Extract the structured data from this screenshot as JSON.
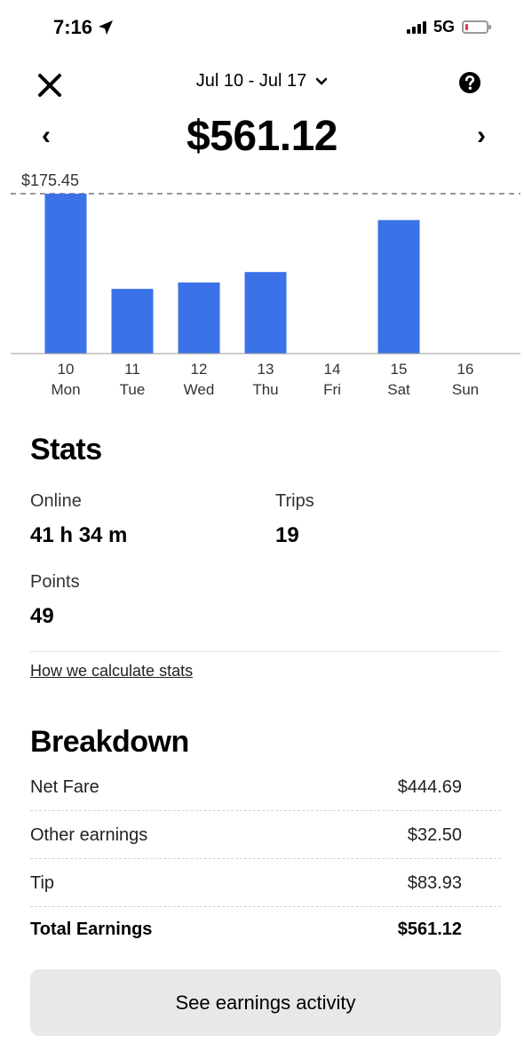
{
  "status_bar": {
    "time": "7:16",
    "network": "5G"
  },
  "header": {
    "date_range": "Jul 10 - Jul 17",
    "total": "$561.12"
  },
  "chart_data": {
    "type": "bar",
    "categories": [
      "10 Mon",
      "11 Tue",
      "12 Wed",
      "13 Thu",
      "14 Fri",
      "15 Sat",
      "16 Sun"
    ],
    "day_numbers": [
      "10",
      "11",
      "12",
      "13",
      "14",
      "15",
      "16"
    ],
    "day_names": [
      "Mon",
      "Tue",
      "Wed",
      "Thu",
      "Fri",
      "Sat",
      "Sun"
    ],
    "values": [
      175.45,
      71,
      78,
      89.5,
      0,
      146.5,
      0
    ],
    "max_label": "$175.45",
    "ylim": [
      0,
      175.45
    ],
    "bar_color": "#3b72e8"
  },
  "stats": {
    "title": "Stats",
    "online_label": "Online",
    "online_value": "41 h 34 m",
    "trips_label": "Trips",
    "trips_value": "19",
    "points_label": "Points",
    "points_value": "49",
    "how_link": "How we calculate stats"
  },
  "breakdown": {
    "title": "Breakdown",
    "rows": [
      {
        "label": "Net Fare",
        "value": "$444.69"
      },
      {
        "label": "Other earnings",
        "value": "$32.50"
      },
      {
        "label": "Tip",
        "value": "$83.93"
      },
      {
        "label": "Total Earnings",
        "value": "$561.12"
      }
    ]
  },
  "cta_label": "See earnings activity",
  "icons": [
    "location-arrow-icon",
    "signal-icon",
    "battery-icon",
    "close-icon",
    "chevron-down-icon",
    "help-icon",
    "chevron-left-icon",
    "chevron-right-icon"
  ]
}
